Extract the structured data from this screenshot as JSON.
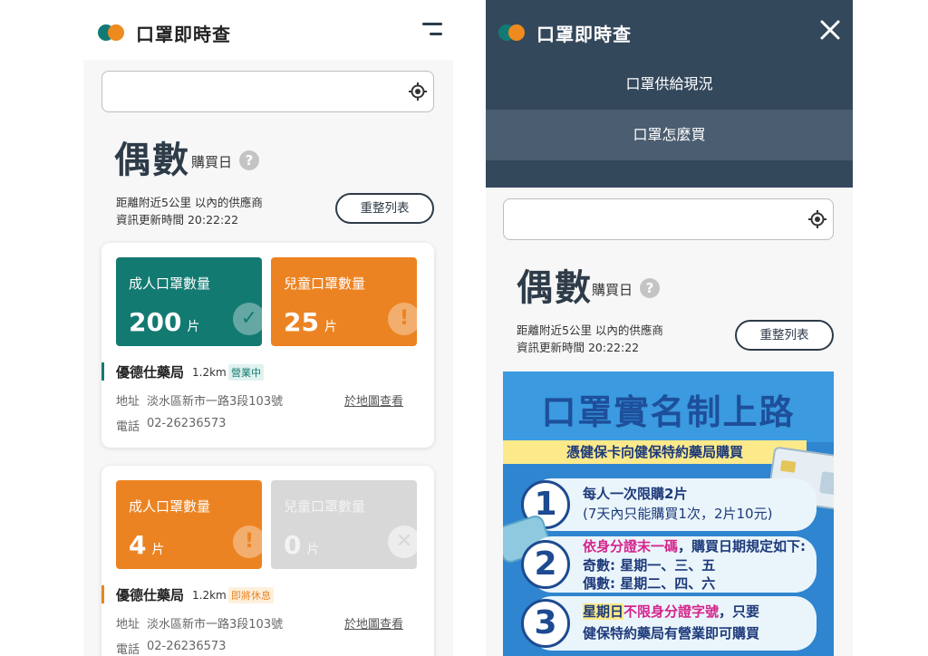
{
  "colors": {
    "teal": "#137a72",
    "orange": "#ec8322",
    "grey": "#d8d8d8",
    "navy": "#2e3b48",
    "menu_bg": "#34485c",
    "menu_active": "#4b5d70"
  },
  "app": {
    "title": "口罩即時查"
  },
  "left": {
    "heading": "偶數",
    "heading_suffix": "購買日",
    "help_symbol": "?",
    "distance_text": "距離附近5公里 以內的供應商",
    "updated_text": "資訊更新時間 20:22:22",
    "refresh_label": "重整列表",
    "pharmacies": [
      {
        "adult_label": "成人口罩數量",
        "adult_count": "200",
        "adult_unit": "片",
        "adult_status_icon": "check-icon",
        "child_label": "兒童口罩數量",
        "child_count": "25",
        "child_unit": "片",
        "child_status_icon": "exclamation-icon",
        "name": "優德仕藥局",
        "distance": "1.2km",
        "status": "營業中",
        "address_label": "地址",
        "address": "淡水區新市一路3段103號",
        "map_link": "於地圖查看",
        "phone_label": "電話",
        "phone": "02-26236573"
      },
      {
        "adult_label": "成人口罩數量",
        "adult_count": "4",
        "adult_unit": "片",
        "adult_status_icon": "exclamation-icon",
        "child_label": "兒童口罩數量",
        "child_count": "0",
        "child_unit": "片",
        "child_status_icon": "x-icon",
        "name": "優德仕藥局",
        "distance": "1.2km",
        "status": "即將休息",
        "address_label": "地址",
        "address": "淡水區新市一路3段103號",
        "map_link": "於地圖查看",
        "phone_label": "電話",
        "phone": "02-26236573"
      }
    ]
  },
  "right": {
    "menu": [
      {
        "label": "口罩供給現況",
        "active": false
      },
      {
        "label": "口罩怎麼買",
        "active": true
      }
    ],
    "heading": "偶數",
    "heading_suffix": "購買日",
    "help_symbol": "?",
    "distance_text": "距離附近5公里 以內的供應商",
    "updated_text": "資訊更新時間 20:22:22",
    "refresh_label": "重整列表",
    "poster": {
      "title": "口罩實名制上路",
      "subtitle": "憑健保卡向健保特約藥局購買",
      "steps": [
        {
          "num": "1",
          "line1": "每人一次限購2片",
          "line2": "(7天內只能購買1次，2片10元)"
        },
        {
          "num": "2",
          "line1a": "依身分證末一碼",
          "line1b": "，購買日期規定如下:",
          "line2": "奇數: 星期一、三、五",
          "line3": "偶數: 星期二、四、六"
        },
        {
          "num": "3",
          "line1a": "星期日",
          "line1b": "不限身分證字號",
          "line1c": "，只要",
          "line2": "健保特約藥局有營業即可購買"
        }
      ]
    }
  }
}
